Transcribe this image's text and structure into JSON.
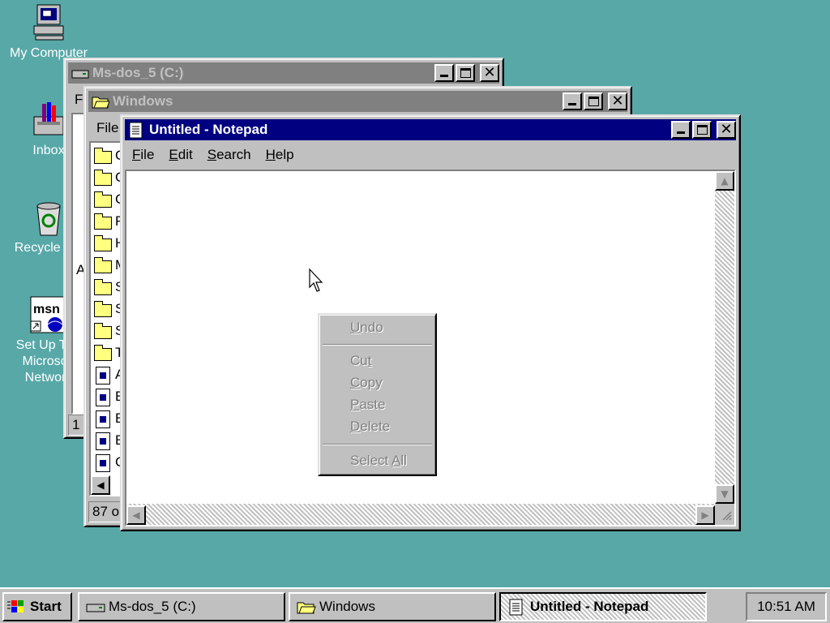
{
  "desktop": {
    "icons": [
      {
        "label": "My Computer",
        "icon": "my-computer-icon"
      },
      {
        "label": "Inbox",
        "icon": "inbox-icon"
      },
      {
        "label": "Recycle Bin",
        "icon": "recycle-bin-icon"
      },
      {
        "label": "Set Up The\nMicrosoft\nNetwork",
        "icon": "msn-icon"
      }
    ]
  },
  "windows": {
    "msdos": {
      "title": "Ms-dos_5 (C:)",
      "menu_first": "F",
      "side_letter": "A",
      "status_partial": "1"
    },
    "windows_folder": {
      "title": "Windows",
      "menu_first": "File",
      "items_partial": [
        "C",
        "C",
        "C",
        "F",
        "H",
        "M",
        "S",
        "S",
        "S",
        "T",
        "A",
        "E",
        "E",
        "E",
        "C"
      ],
      "status_partial": "87 o"
    },
    "notepad": {
      "title": "Untitled - Notepad",
      "menu": [
        {
          "label": "File",
          "accel": "F",
          "rest": "ile"
        },
        {
          "label": "Edit",
          "accel": "E",
          "rest": "dit"
        },
        {
          "label": "Search",
          "accel": "S",
          "rest": "earch"
        },
        {
          "label": "Help",
          "accel": "H",
          "rest": "elp"
        }
      ],
      "content": ""
    }
  },
  "context_menu": {
    "undo": {
      "accel": "U",
      "rest": "ndo"
    },
    "cut": {
      "pre": "Cu",
      "accel": "t",
      "post": ""
    },
    "copy": {
      "pre": "",
      "accel": "C",
      "post": "opy"
    },
    "paste": {
      "pre": "",
      "accel": "P",
      "post": "aste"
    },
    "delete": {
      "pre": "",
      "accel": "D",
      "post": "elete"
    },
    "select_all": {
      "pre": "Select ",
      "accel": "A",
      "post": "ll"
    }
  },
  "taskbar": {
    "start_label": "Start",
    "buttons": [
      {
        "label": "Ms-dos_5 (C:)",
        "icon": "drive-icon",
        "active": false
      },
      {
        "label": "Windows",
        "icon": "folder-icon",
        "active": false
      },
      {
        "label": "Untitled - Notepad",
        "icon": "notepad-icon",
        "active": true
      }
    ],
    "clock": "10:51 AM"
  },
  "colors": {
    "desktop": "#58a8a8",
    "active_title": "#000080",
    "inactive_title": "#808080",
    "face": "#c0c0c0"
  }
}
